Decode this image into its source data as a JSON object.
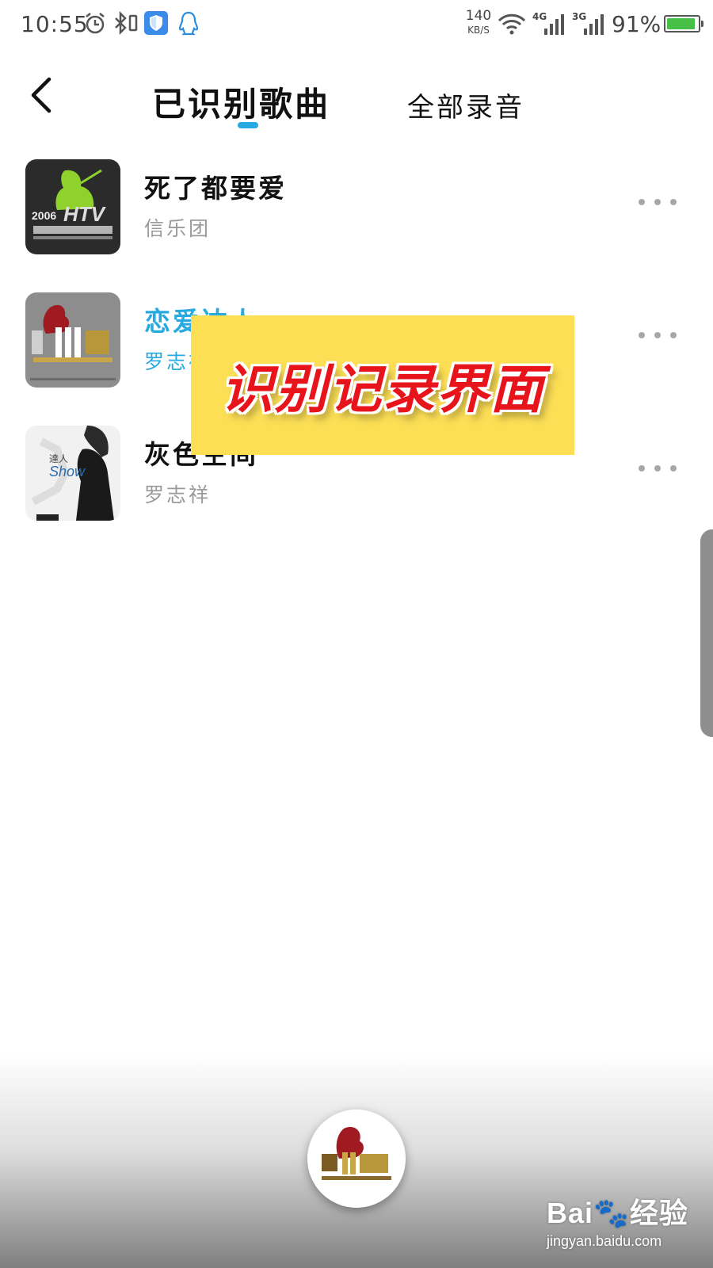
{
  "status_bar": {
    "time": "10:55",
    "net_speed_value": "140",
    "net_speed_unit": "KB/S",
    "signal_1_label": "4G",
    "signal_2_label": "3G",
    "battery_percent": "91%",
    "battery_level": 0.91,
    "icons": [
      "alarm-icon",
      "bluetooth-icon",
      "shield-app-icon",
      "qq-icon",
      "wifi-icon",
      "signal-4g-icon",
      "signal-3g-icon",
      "battery-icon"
    ]
  },
  "header": {
    "back_icon": "chevron-left-icon",
    "tab_active": "已识别歌曲",
    "tab_inactive": "全部录音",
    "indicator_color": "#27a9e1"
  },
  "songs": [
    {
      "title": "死了都要爱",
      "artist": "信乐团",
      "playing": false,
      "cover": "HTV album art"
    },
    {
      "title": "恋爱达人",
      "artist": "罗志祥",
      "playing": true,
      "cover": "MP3 2006 album art"
    },
    {
      "title": "灰色空间",
      "artist": "罗志祥",
      "playing": false,
      "cover": "Show Luo photo album art"
    }
  ],
  "overlay": {
    "text": "识别记录界面"
  },
  "watermark": {
    "logo": "Bai🐾经验",
    "url": "jingyan.baidu.com"
  },
  "colors": {
    "accent": "#27a9e1",
    "overlay_bg": "#fddf55",
    "overlay_text": "#e8141c"
  }
}
